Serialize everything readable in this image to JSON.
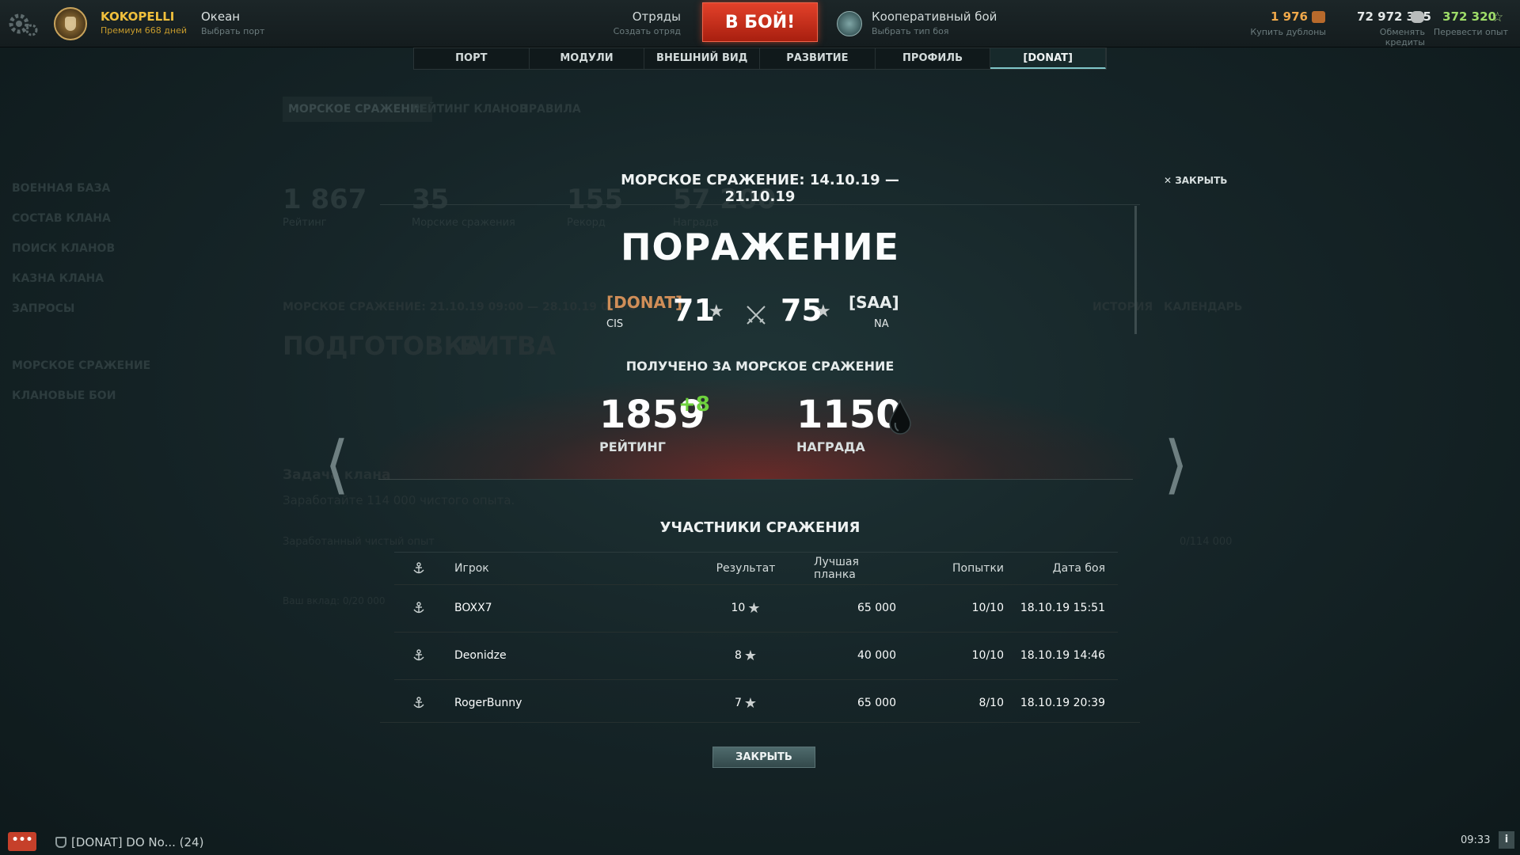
{
  "topbar": {
    "player_name": "KOKOPELLI",
    "premium_text": "Премиум 668 дней",
    "port_name": "Океан",
    "port_sub": "Выбрать порт",
    "squad_label": "Отряды",
    "squad_sub": "Создать отряд",
    "battle_button": "В БОЙ!",
    "battle_type": "Кооперативный бой",
    "battle_type_sub": "Выбрать тип боя",
    "doubloons": "1 976",
    "doubloons_sub": "Купить дублоны",
    "credits": "72 972 375",
    "credits_sub": "Обменять кредиты",
    "free_xp": "372 320",
    "free_xp_sub": "Перевести опыт"
  },
  "tabs": [
    {
      "label": "ПОРТ"
    },
    {
      "label": "МОДУЛИ"
    },
    {
      "label": "ВНЕШНИЙ ВИД"
    },
    {
      "label": "РАЗВИТИЕ"
    },
    {
      "label": "ПРОФИЛЬ"
    },
    {
      "label": "[DONAT]"
    }
  ],
  "background": {
    "subtabs": [
      "МОРСКОЕ СРАЖЕНИЕ",
      "РЕЙТИНГ КЛАНОВ",
      "ПРАВИЛА"
    ],
    "sidebar": [
      "ВОЕННАЯ БАЗА",
      "СОСТАВ КЛАНА",
      "ПОИСК КЛАНОВ",
      "КАЗНА КЛАНА",
      "ЗАПРОСЫ",
      "МОРСКОЕ СРАЖЕНИЕ",
      "КЛАНОВЫЕ БОИ"
    ],
    "stats": [
      {
        "value": "1 867",
        "label": "Рейтинг"
      },
      {
        "value": "35",
        "label": "Морские сражения"
      },
      {
        "value": "155",
        "label": "Рекорд"
      },
      {
        "value": "57 200",
        "label": "Награда"
      }
    ],
    "period": "МОРСКОЕ СРАЖЕНИЕ: 21.10.19 09:00 — 28.10.19 09:00",
    "history": "ИСТОРИЯ",
    "calendar": "КАЛЕНДАРЬ",
    "phase_prep": "ПОДГОТОВКА",
    "phase_battle": "БИТВА",
    "task_title": "Задача клана",
    "task_text": "Заработайте 114 000 чистого опыта.",
    "earned_label": "Заработанный чистый опыт",
    "earned_total": "0/114 000",
    "contribution": "Ваш вклад: 0/20 000"
  },
  "modal": {
    "title": "МОРСКОЕ СРАЖЕНИЕ: 14.10.19 — 21.10.19",
    "close_top": "ЗАКРЫТЬ",
    "result": "ПОРАЖЕНИЕ",
    "left_clan": {
      "tag": "[DONAT]",
      "region": "CIS",
      "score": "71"
    },
    "right_clan": {
      "tag": "[SAA]",
      "region": "NA",
      "score": "75"
    },
    "received_title": "ПОЛУЧЕНО ЗА МОРСКОЕ СРАЖЕНИЕ",
    "rating_value": "1859",
    "rating_delta": "+8",
    "rating_label": "РЕЙТИНГ",
    "reward_value": "1150",
    "reward_label": "НАГРАДА",
    "participants_title": "УЧАСТНИКИ СРАЖЕНИЯ",
    "columns": {
      "player": "Игрок",
      "result": "Результат",
      "best_plank": "Лучшая планка",
      "attempts": "Попытки",
      "date": "Дата боя"
    },
    "rows": [
      {
        "player": "BOXX7",
        "result": "10",
        "plank": "65 000",
        "attempts": "10/10",
        "date": "18.10.19 15:51"
      },
      {
        "player": "Deonidze",
        "result": "8",
        "plank": "40 000",
        "attempts": "10/10",
        "date": "18.10.19 14:46"
      },
      {
        "player": "RogerBunny",
        "result": "7",
        "plank": "65 000",
        "attempts": "8/10",
        "date": "18.10.19 20:39"
      }
    ],
    "close_button": "ЗАКРЫТЬ"
  },
  "bottombar": {
    "chat_button": "•••",
    "chat_channel": "[DONAT] DO No... (24)",
    "clock": "09:33",
    "info": "i"
  },
  "colors": {
    "battle_button": "#c8321c",
    "player_name": "#f0bf3c",
    "doubloons": "#f0a84a",
    "free_xp": "#9edc68",
    "rating_delta": "#6ed23e",
    "clan_tag": "#d08e58"
  },
  "icons": {
    "settings": "gear-icon",
    "clan_emblem": "clan-emblem",
    "coop_battle": "coop-battle-icon",
    "doubloon": "doubloon-icon",
    "credit": "credit-icon",
    "free_xp": "star-icon",
    "vs": "crossed-swords-icon",
    "reward": "oil-drop-icon",
    "row": "anchor-icon"
  }
}
